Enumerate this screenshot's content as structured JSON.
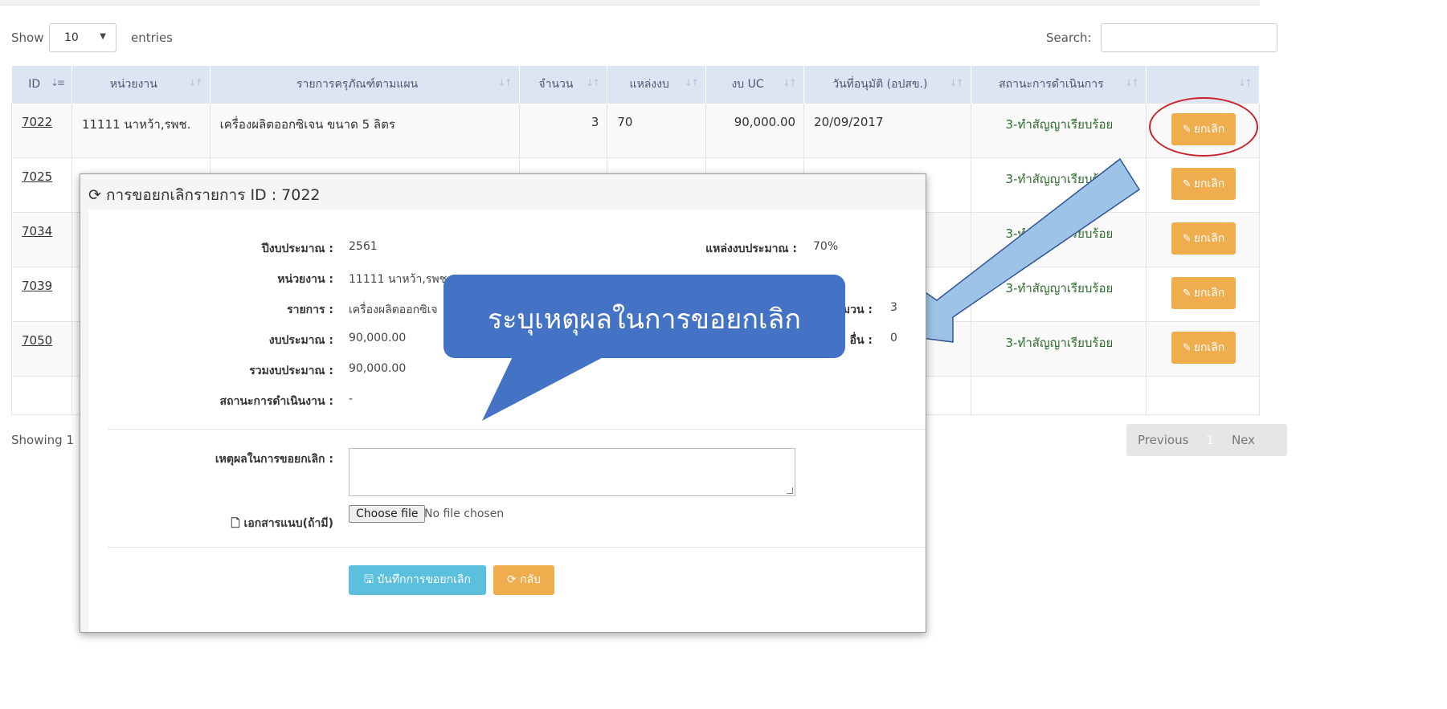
{
  "controls": {
    "show_label": "Show",
    "entries_value": "10",
    "entries_label": "entries",
    "search_label": "Search:"
  },
  "table": {
    "headers": [
      "ID",
      "หน่วยงาน",
      "รายการครุภัณฑ์ตามแผน",
      "จำนวน",
      "แหล่งงบ",
      "งบ UC",
      "วันที่อนุมัติ (อปสข.)",
      "สถานะการดำเนินการ",
      ""
    ],
    "rows": [
      {
        "id": "7022",
        "unit": "11111 นาหว้า,รพช.",
        "item": "เครื่องผลิตออกซิเจน ขนาด 5 ลิตร",
        "qty": "3",
        "source": "70",
        "uc": "90,000.00",
        "date": "20/09/2017",
        "status": "3-ทำสัญญาเรียบร้อย",
        "action": "ยกเลิก"
      },
      {
        "id": "7025",
        "unit": "",
        "item": "",
        "qty": "",
        "source": "",
        "uc": "",
        "date": "",
        "status": "3-ทำสัญญาเรียบร้อย",
        "action": "ยกเลิก"
      },
      {
        "id": "7034",
        "unit": "",
        "item": "",
        "qty": "",
        "source": "",
        "uc": "",
        "date": "",
        "status": "3-ทำสัญญาเรียบร้อย",
        "action": "ยกเลิก"
      },
      {
        "id": "7039",
        "unit": "",
        "item": "",
        "qty": "",
        "source": "",
        "uc": "",
        "date": "",
        "status": "3-ทำสัญญาเรียบร้อย",
        "action": "ยกเลิก"
      },
      {
        "id": "7050",
        "unit": "",
        "item": "",
        "qty": "",
        "source": "",
        "uc": "",
        "date": "",
        "status": "3-ทำสัญญาเรียบร้อย",
        "action": "ยกเลิก"
      }
    ]
  },
  "footer": {
    "showing_text": "Showing 1",
    "previous": "Previous",
    "page": "1",
    "next": "Nex"
  },
  "modal": {
    "title": "การขอยกเลิกรายการ ID : 7022",
    "fields": {
      "budget_year_label": "ปีงบประมาณ :",
      "budget_year": "2561",
      "budget_source_label": "แหล่งงบประมาณ :",
      "budget_source": "70%",
      "unit_label": "หน่วยงาน :",
      "unit": "11111 นาหว้า,รพช.",
      "item_label": "รายการ :",
      "item": "เครื่องผลิตออกซิเจ",
      "qty_label": "มวน :",
      "qty": "3",
      "budget_label": "งบประมาณ :",
      "budget": "90,000.00",
      "other_label": "อื่น :",
      "other": "0",
      "total_label": "รวมงบประมาณ :",
      "total": "90,000.00",
      "progress_label": "สถานะการดำเนินงาน :",
      "progress": "-",
      "reason_label": "เหตุผลในการขอยกเลิก :",
      "attach_label": "เอกสารแนบ(ถ้ามี)",
      "file_button": "Choose file",
      "file_status": "No file chosen"
    },
    "save_button": "บันทึกการขอยกเลิก",
    "back_button": "กลับ"
  },
  "annotation": {
    "callout_text": "ระบุเหตุผลในการขอยกเลิก",
    "callout_color": "#4472c4",
    "arrow_color": "#9dc3e6",
    "ring_color": "#c8232c"
  }
}
